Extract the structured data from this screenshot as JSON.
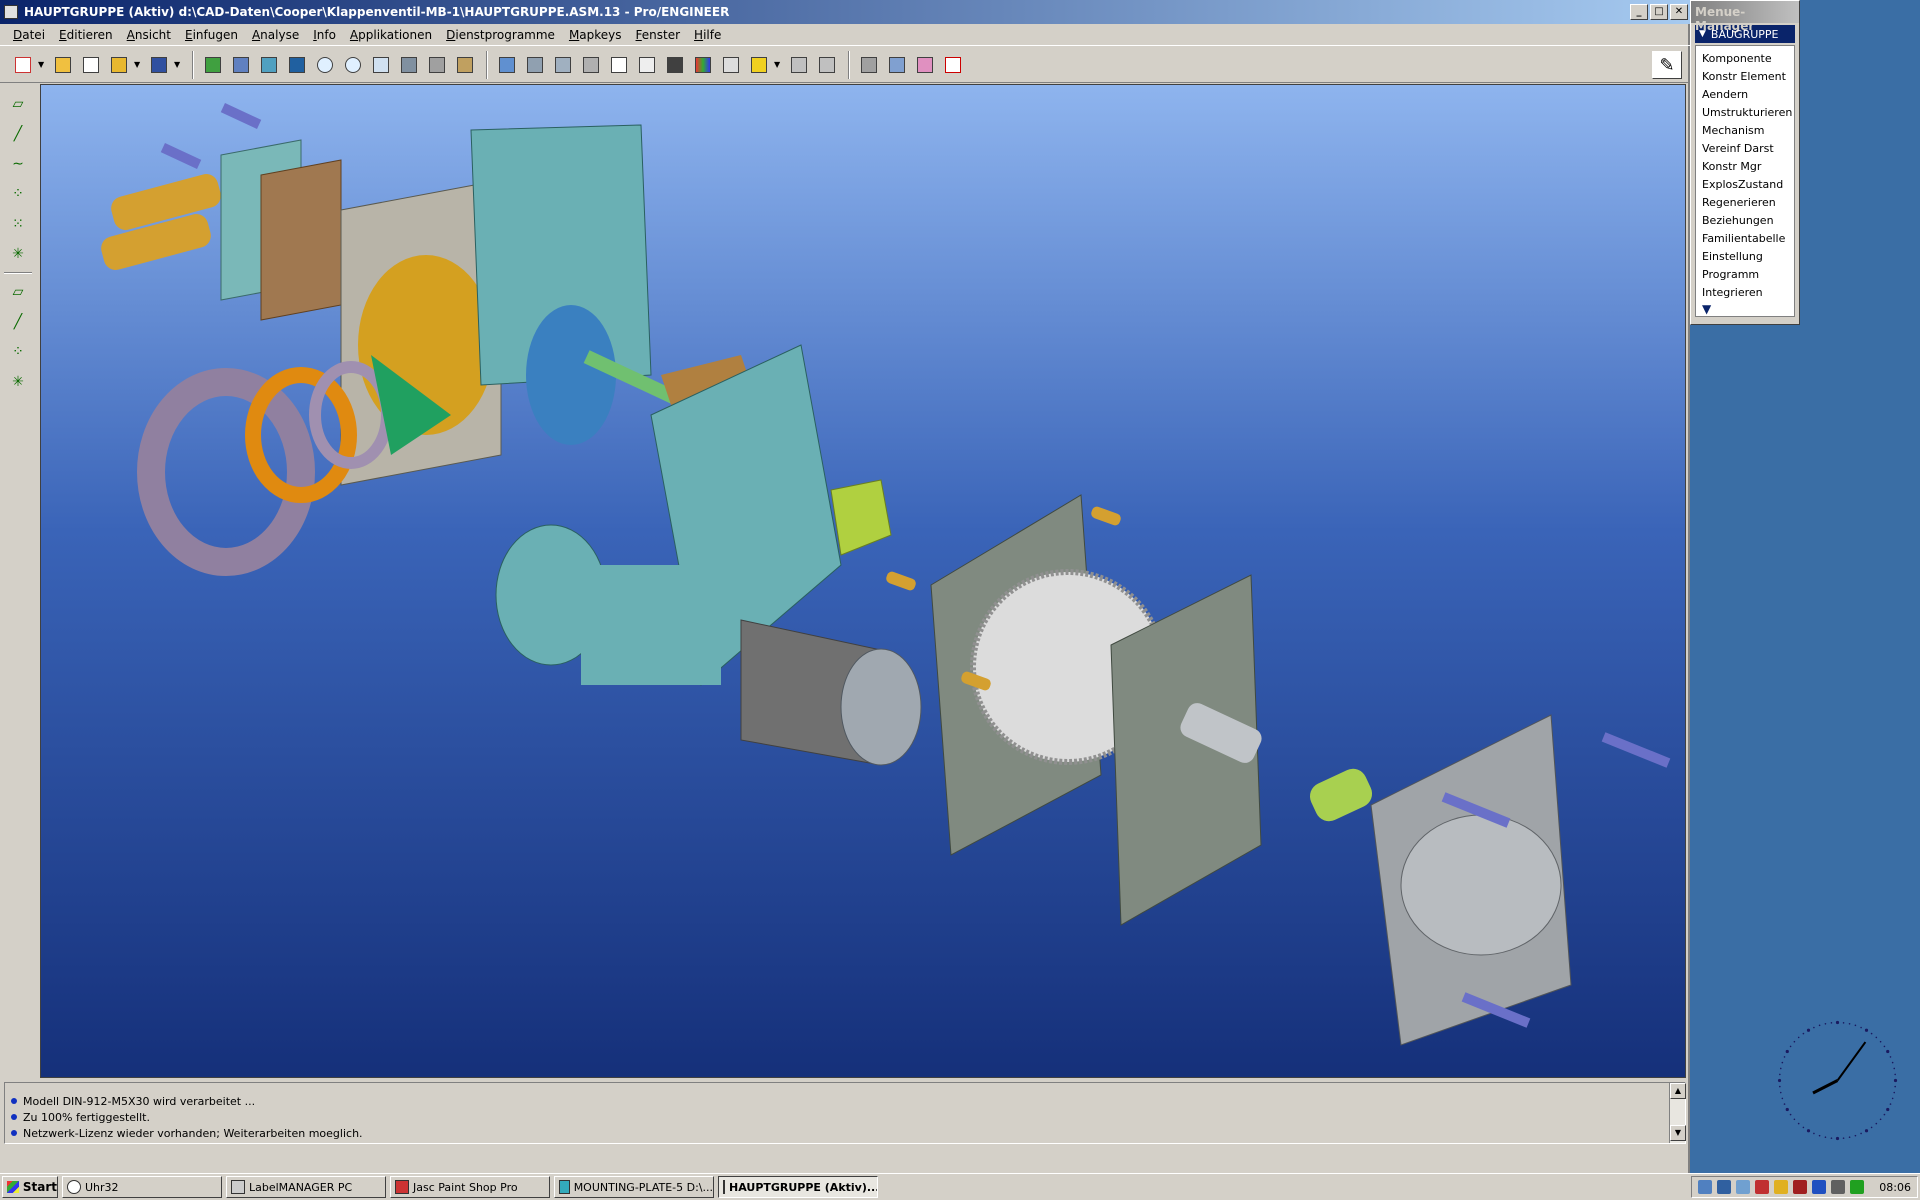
{
  "window": {
    "title": "HAUPTGRUPPE (Aktiv)  d:\\CAD-Daten\\Cooper\\Klappenventil-MB-1\\HAUPTGRUPPE.ASM.13 - Pro/ENGINEER",
    "minimize": "_",
    "maximize": "□",
    "close": "✕"
  },
  "menubar": [
    "Datei",
    "Editieren",
    "Ansicht",
    "Einfugen",
    "Analyse",
    "Info",
    "Applikationen",
    "Dienstprogramme",
    "Mapkeys",
    "Fenster",
    "Hilfe"
  ],
  "toolbar": {
    "icons": [
      "open-icon",
      "save-icon",
      "print-icon",
      "regenerate-icon",
      "zoom-in-icon",
      "zoom-out-icon",
      "refit-icon",
      "orient-icon",
      "spin-icon",
      "shading-icon",
      "hidden-line-icon",
      "wireframe-icon",
      "datum-plane-icon",
      "datum-axis-icon",
      "datum-point-icon",
      "coordsys-icon",
      "select-icon",
      "close-window-icon"
    ],
    "pen_glyph": "✎"
  },
  "menu_manager": {
    "title": "Menue-Manager",
    "header": "BAUGRUPPE",
    "header_glyph": "▼",
    "items": [
      "Komponente",
      "Konstr Element",
      "Aendern",
      "Umstrukturieren",
      "Mechanism",
      "Vereinf Darst",
      "Konstr Mgr",
      "ExplosZustand",
      "Regenerieren",
      "Beziehungen",
      "Familientabelle",
      "Einstellung",
      "Programm",
      "Integrieren"
    ],
    "more_glyph": "▼"
  },
  "messages": [
    "Modell DIN-912-M5X30 wird verarbeitet ...",
    "Zu 100% fertiggestellt.",
    "Netzwerk-Lizenz wieder vorhanden; Weiterarbeiten moeglich."
  ],
  "taskbar": {
    "start": "Start",
    "tasks": [
      {
        "label": "Uhr32",
        "active": false
      },
      {
        "label": "LabelMANAGER PC",
        "active": false
      },
      {
        "label": "Jasc Paint Shop Pro",
        "active": false
      },
      {
        "label": "MOUNTING-PLATE-5  D:\\...",
        "active": false
      },
      {
        "label": "HAUPTGRUPPE (Aktiv)...",
        "active": true
      }
    ],
    "time": "08:06"
  },
  "clock": {
    "hour": 8,
    "minute": 6
  }
}
